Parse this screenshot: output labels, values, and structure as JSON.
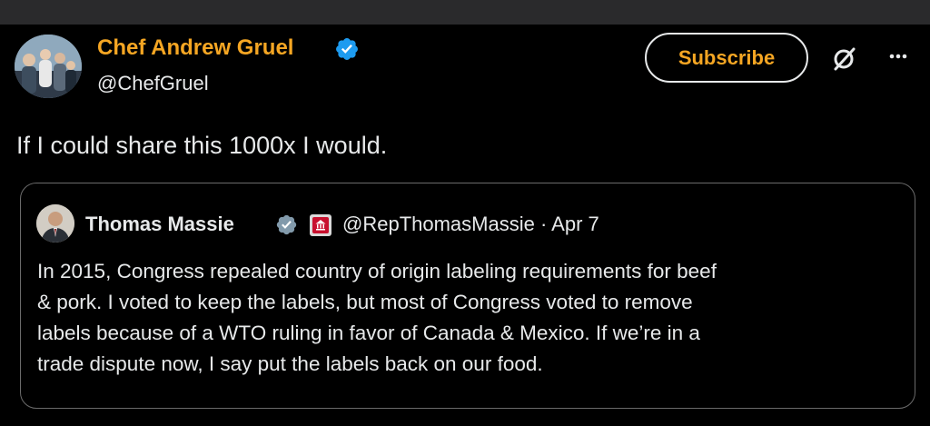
{
  "post": {
    "author_name": "Chef Andrew Gruel",
    "author_handle": "@ChefGruel",
    "verified_icon": "verified-badge-icon",
    "subscribe_label": "Subscribe",
    "text": "If I could share this 1000x I would."
  },
  "quote": {
    "author_name": "Thomas Massie",
    "meta": "@RepThomasMassie · Apr 7",
    "affiliate_icon": "us-house-affiliate-icon",
    "text": "In 2015, Congress repealed country of origin labeling requirements for beef\n& pork. I voted to keep the labels, but most of Congress voted to remove\nlabels because of a WTO ruling in favor of Canada & Mexico. If we’re in a\ntrade dispute now, I say put the labels back on our food."
  },
  "colors": {
    "background": "#000000",
    "accent_gold": "#f5a623",
    "verified_blue": "#1d9bf0",
    "verified_gray": "#829aab",
    "text": "#e7e9ea",
    "border": "#6b6b6b"
  }
}
